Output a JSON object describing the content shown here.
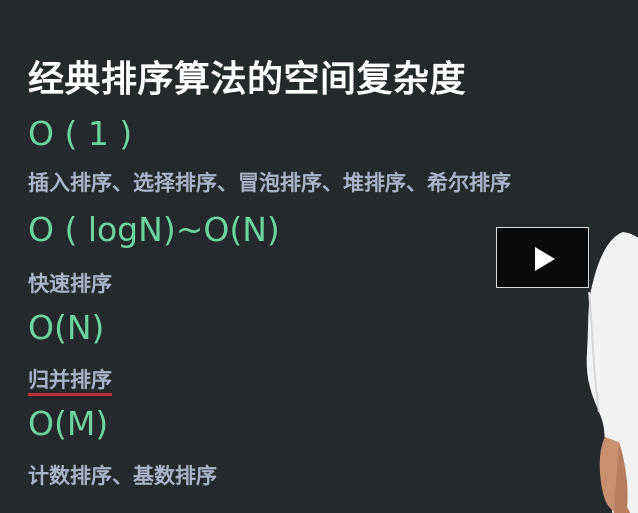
{
  "slide": {
    "title": "经典排序算法的空间复杂度",
    "groups": [
      {
        "complexity": "O ( 1 )",
        "algorithms": "插入排序、选择排序、冒泡排序、堆排序、希尔排序"
      },
      {
        "complexity": "O ( logN)~O(N)",
        "algorithms": "快速排序"
      },
      {
        "complexity": "O(N)",
        "algorithms": "归并排序"
      },
      {
        "complexity": "O(M)",
        "algorithms": "计数排序、基数排序"
      }
    ]
  },
  "player": {
    "play_icon": "play-icon"
  },
  "colors": {
    "background": "#24292c",
    "title": "#ffffff",
    "complexity": "#6dd3a2",
    "algorithms": "#a7b4c9",
    "underline": "#c0303a"
  }
}
